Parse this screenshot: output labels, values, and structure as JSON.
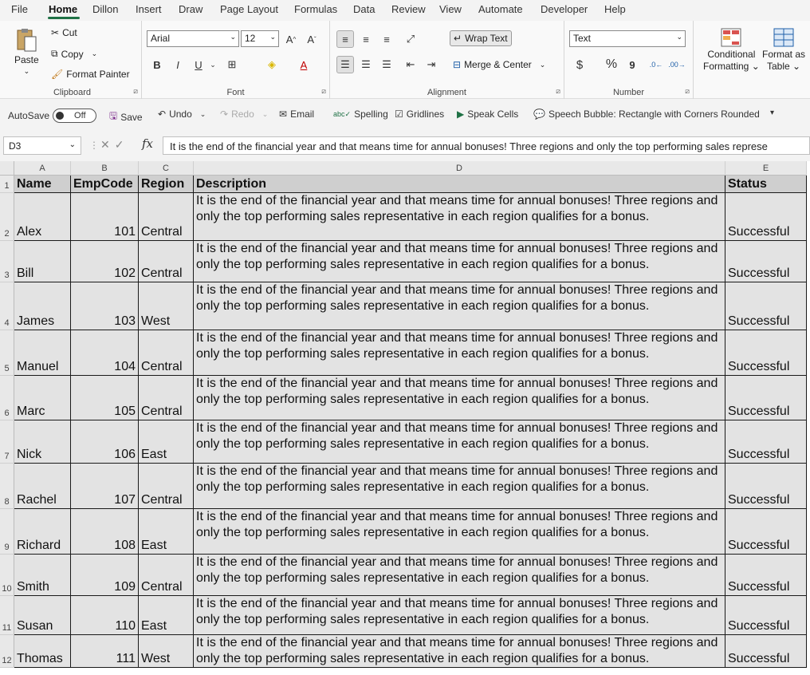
{
  "menu": {
    "file": "File",
    "home": "Home",
    "dillon": "Dillon",
    "insert": "Insert",
    "draw": "Draw",
    "page_layout": "Page Layout",
    "formulas": "Formulas",
    "data": "Data",
    "review": "Review",
    "view": "View",
    "automate": "Automate",
    "developer": "Developer",
    "help": "Help"
  },
  "clipboard": {
    "paste": "Paste",
    "cut": "Cut",
    "copy": "Copy",
    "format_painter": "Format Painter",
    "label": "Clipboard"
  },
  "font": {
    "name": "Arial",
    "size": "12",
    "bold": "B",
    "italic": "I",
    "underline": "U",
    "label": "Font"
  },
  "alignment": {
    "wrap_text": "Wrap Text",
    "merge_center": "Merge & Center",
    "label": "Alignment"
  },
  "number": {
    "format": "Text",
    "currency": "$",
    "percent": "%",
    "comma": "9",
    "label": "Number"
  },
  "styles": {
    "conditional": "Conditional",
    "formatting": "Formatting",
    "format_as": "Format as",
    "table": "Table"
  },
  "qat": {
    "autosave": "AutoSave",
    "off": "Off",
    "save": "Save",
    "undo": "Undo",
    "redo": "Redo",
    "email": "Email",
    "spelling": "Spelling",
    "gridlines": "Gridlines",
    "speak_cells": "Speak Cells",
    "speech_bubble": "Speech Bubble: Rectangle with Corners Rounded"
  },
  "formula_bar": {
    "name_box": "D3",
    "content": "It is the end of the financial year and that means time for annual bonuses! Three regions and only the top performing sales represe"
  },
  "columns": [
    "A",
    "B",
    "C",
    "D",
    "E"
  ],
  "header": {
    "row": "1",
    "name": "Name",
    "code": "EmpCode",
    "region": "Region",
    "desc": "Description",
    "status": "Status"
  },
  "rows": [
    {
      "row": "2",
      "name": "Alex",
      "code": "101",
      "region": "Central",
      "desc": "It is the end of the financial year and that means time for annual bonuses! Three regions and only the top performing sales representative in each region qualifies for a bonus.",
      "status": "Successful"
    },
    {
      "row": "3",
      "name": "Bill",
      "code": "102",
      "region": "Central",
      "desc": "It is the end of the financial year and that means time for annual bonuses! Three regions and only the top performing sales representative in each region qualifies for a bonus.",
      "status": "Successful"
    },
    {
      "row": "4",
      "name": "James",
      "code": "103",
      "region": "West",
      "desc": "It is the end of the financial year and that means time for annual bonuses! Three regions and only the top performing sales representative in each region qualifies for a bonus.",
      "status": "Successful"
    },
    {
      "row": "5",
      "name": "Manuel",
      "code": "104",
      "region": "Central",
      "desc": "It is the end of the financial year and that means time for annual bonuses! Three regions and only the top performing sales representative in each region qualifies for a bonus.",
      "status": "Successful"
    },
    {
      "row": "6",
      "name": "Marc",
      "code": "105",
      "region": "Central",
      "desc": "It is the end of the financial year and that means time for annual bonuses! Three regions and only the top performing sales representative in each region qualifies for a bonus.",
      "status": "Successful"
    },
    {
      "row": "7",
      "name": "Nick",
      "code": "106",
      "region": "East",
      "desc": "It is the end of the financial year and that means time for annual bonuses! Three regions and only the top performing sales representative in each region qualifies for a bonus.",
      "status": "Successful"
    },
    {
      "row": "8",
      "name": "Rachel",
      "code": "107",
      "region": "Central",
      "desc": "It is the end of the financial year and that means time for annual bonuses! Three regions and only the top performing sales representative in each region qualifies for a bonus.",
      "status": "Successful"
    },
    {
      "row": "9",
      "name": "Richard",
      "code": "108",
      "region": "East",
      "desc": "It is the end of the financial year and that means time for annual bonuses! Three regions and only the top performing sales representative in each region qualifies for a bonus.",
      "status": "Successful"
    },
    {
      "row": "10",
      "name": "Smith",
      "code": "109",
      "region": "Central",
      "desc": "It is the end of the financial year and that means time for annual bonuses! Three regions and only the top performing sales representative in each region qualifies for a bonus.",
      "status": "Successful"
    },
    {
      "row": "11",
      "name": "Susan",
      "code": "110",
      "region": "East",
      "desc": "It is the end of the financial year and that means time for annual bonuses! Three regions and only the top performing sales representative in each region qualifies for a bonus.",
      "status": "Successful"
    },
    {
      "row": "12",
      "name": "Thomas",
      "code": "111",
      "region": "West",
      "desc": "It is the end of the financial year and that means time for annual bonuses! Three regions and only the top performing sales representative in each region qualifies for a bonus.",
      "status": "Successful"
    }
  ],
  "colors": {
    "accent": "#1f7145",
    "cell_bg": "#e3e3e3",
    "header_bg": "#cfcfcf"
  }
}
